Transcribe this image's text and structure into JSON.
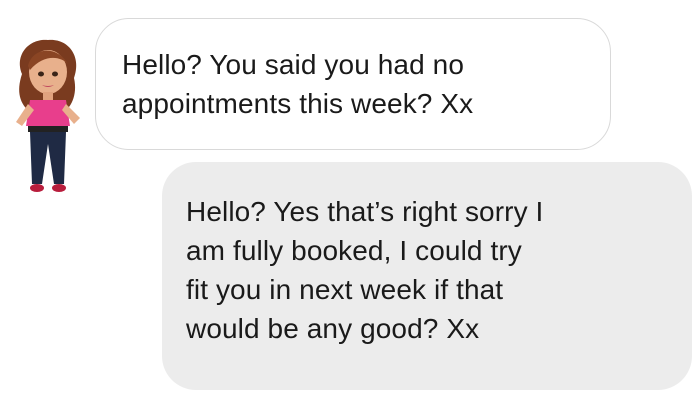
{
  "conversation": {
    "messages": [
      {
        "direction": "incoming",
        "text": "Hello? You said you had no\nappointments this week? Xx"
      },
      {
        "direction": "outgoing",
        "text": "Hello? Yes that’s right sorry I\nam fully booked, I could try\nfit you in next week if that\nwould be any good? Xx"
      }
    ]
  },
  "colors": {
    "incoming_bubble": "#ffffff",
    "incoming_border": "#d9d9d9",
    "outgoing_bubble": "#ececec",
    "text": "#1a1a1a"
  },
  "icons": {
    "sender_avatar": "bitmoji-avatar-icon"
  }
}
